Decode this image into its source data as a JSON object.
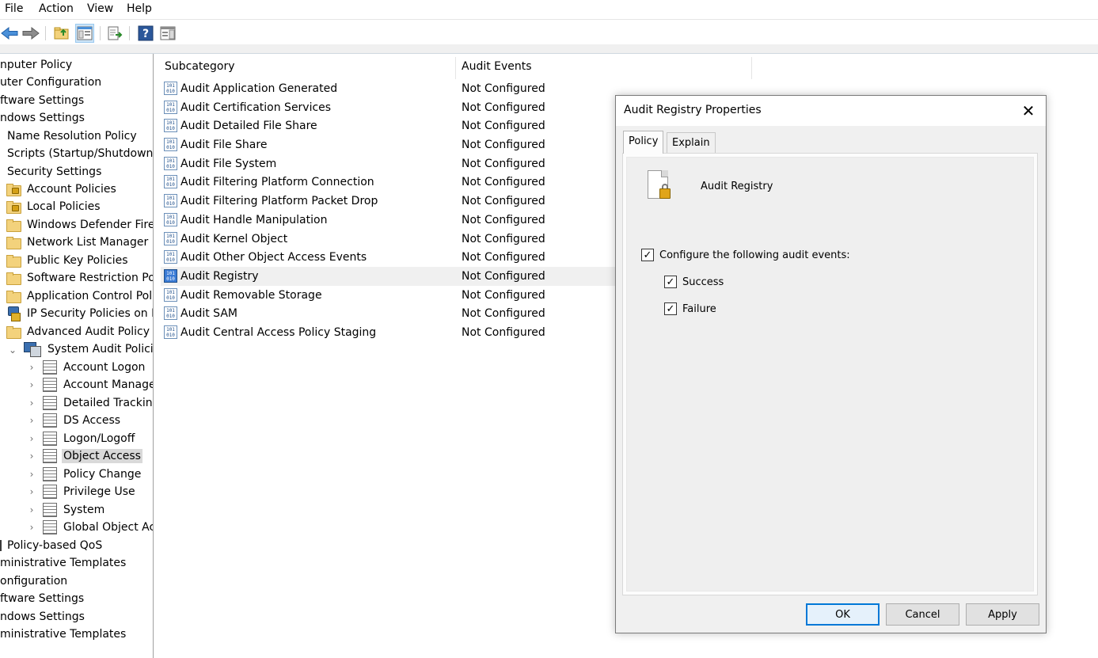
{
  "menubar": {
    "items": [
      "File",
      "Action",
      "View",
      "Help"
    ]
  },
  "toolbar": {
    "buttons": [
      "back-icon",
      "forward-icon",
      "up-folder-icon",
      "show-hide-tree-icon",
      "export-list-icon",
      "help-icon",
      "show-action-pane-icon"
    ]
  },
  "tree": {
    "items": [
      {
        "label": "nputer Policy"
      },
      {
        "label": "uter Configuration"
      },
      {
        "label": "ftware Settings"
      },
      {
        "label": "ndows Settings"
      },
      {
        "label": "Name Resolution Policy"
      },
      {
        "label": "Scripts (Startup/Shutdown)"
      },
      {
        "label": "Security Settings"
      },
      {
        "label": "Account Policies"
      },
      {
        "label": "Local Policies"
      },
      {
        "label": "Windows Defender Firew"
      },
      {
        "label": "Network List Manager Po"
      },
      {
        "label": "Public Key Policies"
      },
      {
        "label": "Software Restriction Polic"
      },
      {
        "label": "Application Control Polic"
      },
      {
        "label": "IP Security Policies on Lo"
      },
      {
        "label": "Advanced Audit Policy Co"
      },
      {
        "label": "System Audit Policies"
      },
      {
        "label": "Account Logon"
      },
      {
        "label": "Account Manage"
      },
      {
        "label": "Detailed Tracking"
      },
      {
        "label": "DS Access"
      },
      {
        "label": "Logon/Logoff"
      },
      {
        "label": "Object Access"
      },
      {
        "label": "Policy Change"
      },
      {
        "label": "Privilege Use"
      },
      {
        "label": "System"
      },
      {
        "label": "Global Object Acc"
      },
      {
        "label": "Policy-based QoS"
      },
      {
        "label": "ministrative Templates"
      },
      {
        "label": "onfiguration"
      },
      {
        "label": "ftware Settings"
      },
      {
        "label": "ndows Settings"
      },
      {
        "label": "ministrative Templates"
      }
    ],
    "selected": "Object Access"
  },
  "list": {
    "columns": [
      "Subcategory",
      "Audit Events"
    ],
    "rows": [
      {
        "name": "Audit Application Generated",
        "value": "Not Configured"
      },
      {
        "name": "Audit Certification Services",
        "value": "Not Configured"
      },
      {
        "name": "Audit Detailed File Share",
        "value": "Not Configured"
      },
      {
        "name": "Audit File Share",
        "value": "Not Configured"
      },
      {
        "name": "Audit File System",
        "value": "Not Configured"
      },
      {
        "name": "Audit Filtering Platform Connection",
        "value": "Not Configured"
      },
      {
        "name": "Audit Filtering Platform Packet Drop",
        "value": "Not Configured"
      },
      {
        "name": "Audit Handle Manipulation",
        "value": "Not Configured"
      },
      {
        "name": "Audit Kernel Object",
        "value": "Not Configured"
      },
      {
        "name": "Audit Other Object Access Events",
        "value": "Not Configured"
      },
      {
        "name": "Audit Registry",
        "value": "Not Configured"
      },
      {
        "name": "Audit Removable Storage",
        "value": "Not Configured"
      },
      {
        "name": "Audit SAM",
        "value": "Not Configured"
      },
      {
        "name": "Audit Central Access Policy Staging",
        "value": "Not Configured"
      }
    ],
    "selected": "Audit Registry"
  },
  "dialog": {
    "title": "Audit Registry Properties",
    "tabs": [
      "Policy",
      "Explain"
    ],
    "active_tab": "Policy",
    "policy_name": "Audit Registry",
    "configure_label": "Configure the following audit events:",
    "configure_checked": true,
    "success_label": "Success",
    "success_checked": true,
    "failure_label": "Failure",
    "failure_checked": true,
    "ok_label": "OK",
    "cancel_label": "Cancel",
    "apply_label": "Apply",
    "check_glyph": "✓",
    "close_glyph": "✕"
  },
  "colors": {
    "selection_gray": "#d9d9d9",
    "accent_blue": "#0078d7",
    "folder_yellow": "#f3d27c"
  }
}
